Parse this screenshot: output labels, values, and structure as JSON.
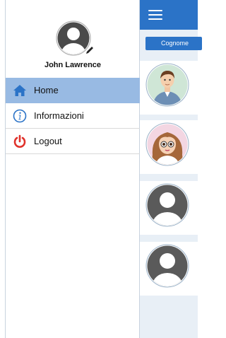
{
  "drawer": {
    "profile_name": "John Lawrence",
    "items": [
      {
        "label": "Home",
        "icon": "home-icon",
        "active": true
      },
      {
        "label": "Informazioni",
        "icon": "info-icon",
        "active": false
      },
      {
        "label": "Logout",
        "icon": "power-icon",
        "active": false
      }
    ]
  },
  "main": {
    "filter_label": "Cognome",
    "accent_color": "#2b73c7",
    "cards": [
      {
        "avatar": "man-cartoon-avatar"
      },
      {
        "avatar": "woman-cartoon-avatar"
      },
      {
        "avatar": "default-person-avatar"
      },
      {
        "avatar": "default-person-avatar"
      }
    ]
  },
  "colors": {
    "active_item": "#98bae3",
    "logout_icon": "#e0322b",
    "nav_icon": "#2b73c7"
  }
}
